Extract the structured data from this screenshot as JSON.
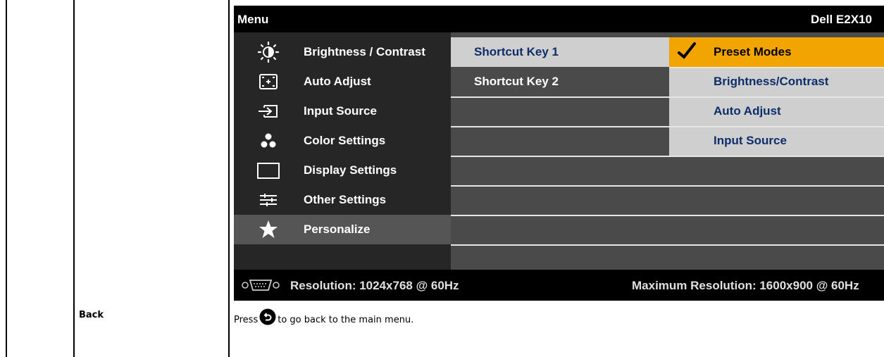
{
  "osd": {
    "title": "Menu",
    "model": "Dell E2X10",
    "menu_items": [
      {
        "label": "Brightness / Contrast",
        "icon": "brightness-icon"
      },
      {
        "label": "Auto Adjust",
        "icon": "auto-adjust-icon"
      },
      {
        "label": "Input Source",
        "icon": "input-source-icon"
      },
      {
        "label": "Color Settings",
        "icon": "color-settings-icon"
      },
      {
        "label": "Display Settings",
        "icon": "display-settings-icon"
      },
      {
        "label": "Other Settings",
        "icon": "other-settings-icon"
      },
      {
        "label": "Personalize",
        "icon": "star-icon",
        "selected": true
      }
    ],
    "submenu": [
      {
        "label": "Shortcut Key 1",
        "active": true
      },
      {
        "label": "Shortcut Key 2",
        "active": false
      }
    ],
    "options": [
      {
        "label": "Preset Modes",
        "selected": true
      },
      {
        "label": "Brightness/Contrast"
      },
      {
        "label": "Auto Adjust"
      },
      {
        "label": "Input Source"
      }
    ],
    "footer": {
      "resolution": "Resolution: 1024x768 @ 60Hz",
      "max_resolution": "Maximum Resolution: 1600x900 @ 60Hz"
    }
  },
  "row": {
    "label": "Back",
    "desc_prefix": "Press",
    "desc_suffix": "to go back to the main menu."
  },
  "colors": {
    "selected_option": "#f2a500",
    "active_item": "#cfcfcf",
    "option_text": "#0d2d6b"
  }
}
